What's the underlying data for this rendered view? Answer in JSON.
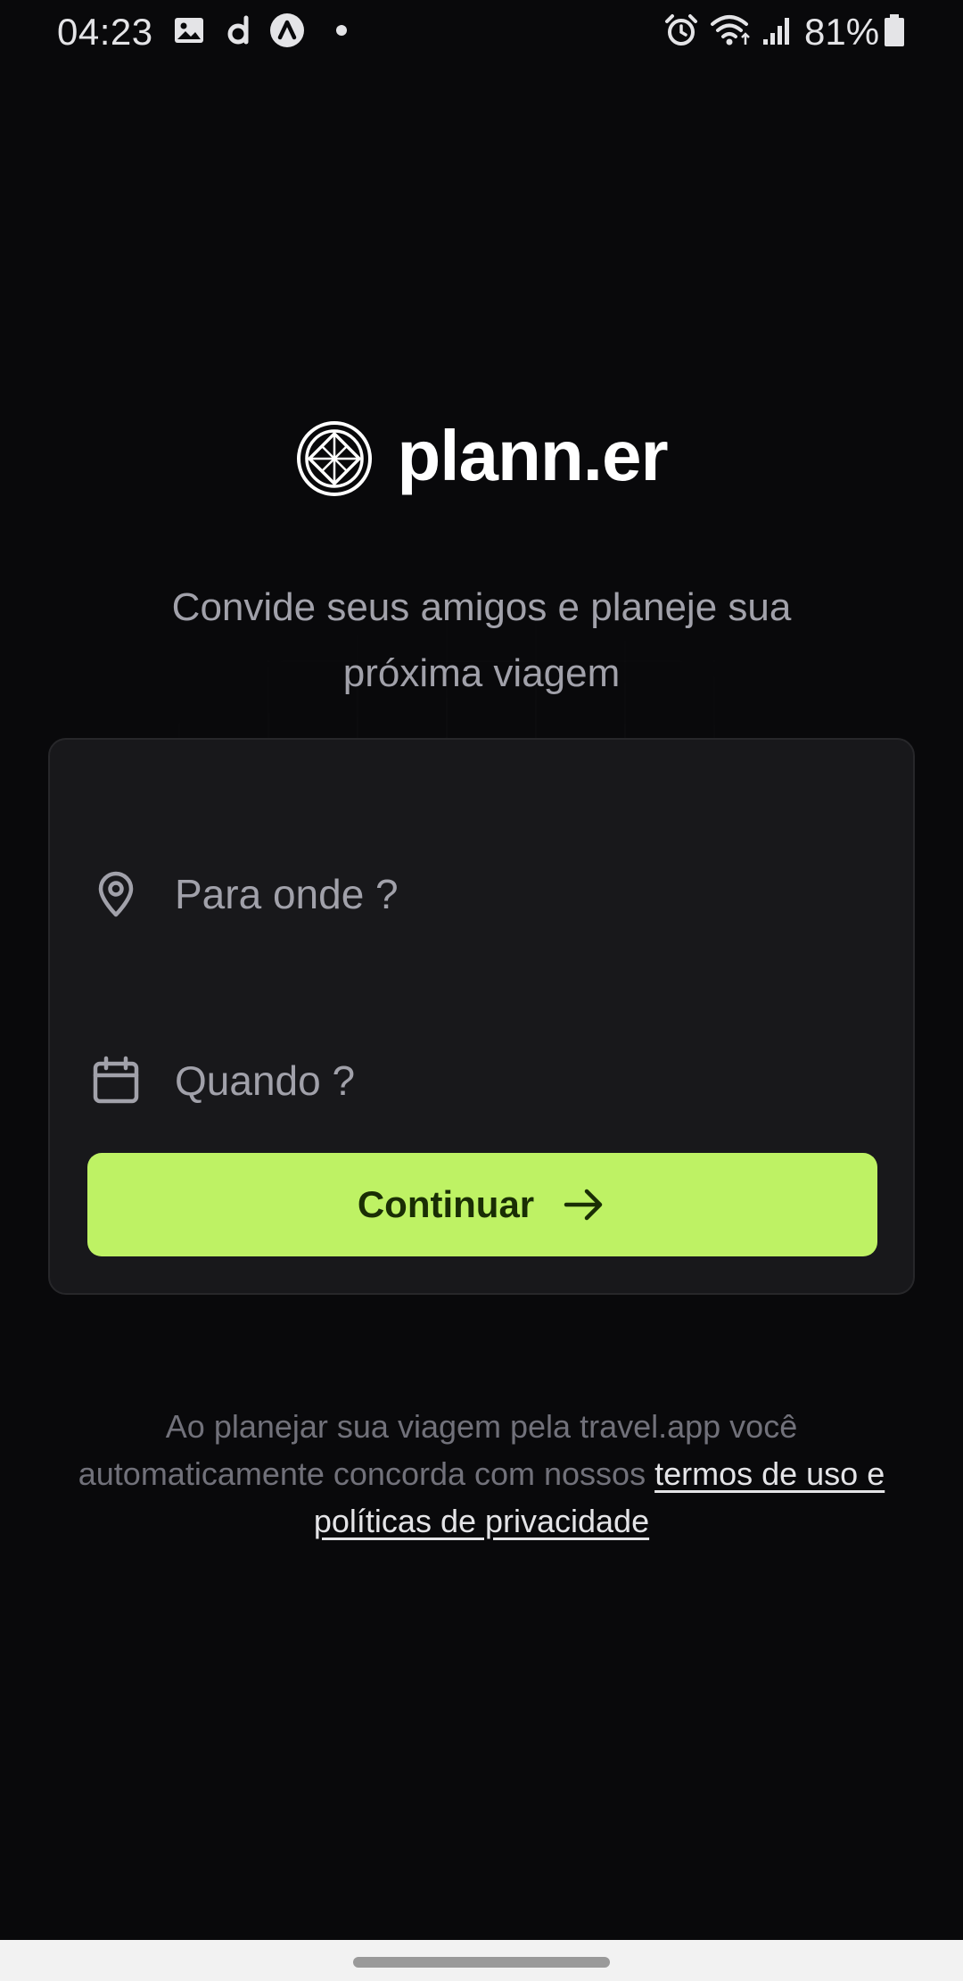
{
  "status_bar": {
    "time": "04:23",
    "battery_percent": "81%",
    "icons": [
      "gallery-icon",
      "app-d-icon",
      "app-a-icon",
      "dot-icon",
      "alarm-icon",
      "wifi-icon",
      "signal-icon",
      "battery-icon"
    ],
    "battery_level": 0.81
  },
  "brand": {
    "name": "plann.er",
    "logo": "globe-logo-icon"
  },
  "tagline": "Convide seus amigos e planeje sua próxima viagem",
  "form": {
    "destination": {
      "icon": "map-pin-icon",
      "placeholder": "Para onde ?",
      "value": ""
    },
    "date": {
      "icon": "calendar-icon",
      "placeholder": "Quando ?",
      "value": ""
    },
    "continue_button": {
      "label": "Continuar",
      "icon": "arrow-right-icon"
    }
  },
  "footer": {
    "text": "Ao planejar sua viagem pela travel.app você automaticamente concorda com nossos",
    "link": "termos de uso e políticas de privacidade"
  },
  "colors": {
    "background": "#09090b",
    "card": "#18181b",
    "accent": "#bef264",
    "accent_text": "#1a2e05",
    "muted_text": "#a1a1aa"
  }
}
